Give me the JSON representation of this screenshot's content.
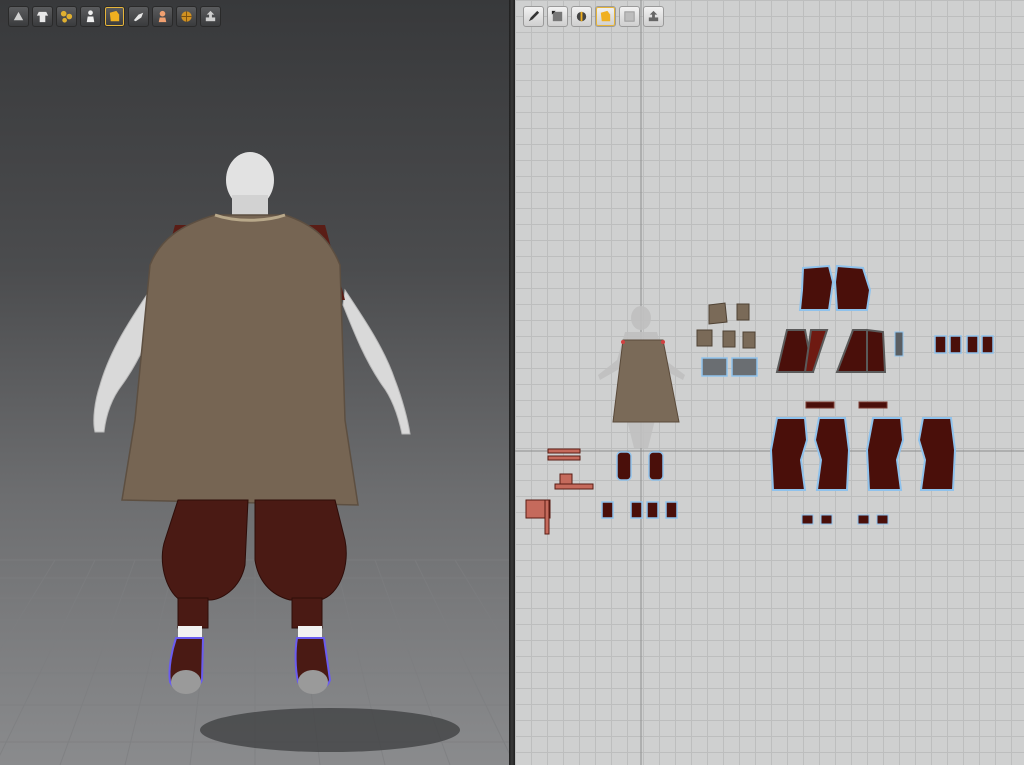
{
  "app": {
    "view_3d": {
      "toolbar": [
        {
          "icon": "select-mesh-icon"
        },
        {
          "icon": "garment-icon"
        },
        {
          "icon": "button-icon"
        },
        {
          "icon": "avatar-pose-icon"
        },
        {
          "icon": "fold-icon"
        },
        {
          "icon": "pin-icon"
        },
        {
          "icon": "avatar-skin-icon"
        },
        {
          "icon": "texture-globe-icon"
        },
        {
          "icon": "export-icon"
        }
      ]
    },
    "view_2d": {
      "toolbar": [
        {
          "icon": "edit-pattern-icon"
        },
        {
          "icon": "transform-pattern-icon"
        },
        {
          "icon": "internal-line-icon"
        },
        {
          "icon": "segment-sewing-icon"
        },
        {
          "icon": "free-sewing-icon"
        },
        {
          "icon": "export-pattern-icon"
        }
      ]
    },
    "colors": {
      "cape": "#7a6a58",
      "pants": "#4a1a14",
      "pattern_fill": "#4a0f0a",
      "pattern_outline": "#8fc2ec",
      "grid": "#bdbebe",
      "avatar": "#d8d8d8"
    }
  }
}
